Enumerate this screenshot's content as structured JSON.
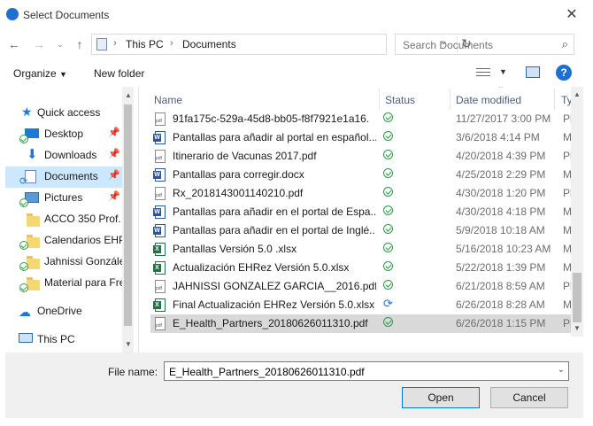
{
  "window": {
    "title": "Select Documents"
  },
  "nav": {
    "back": "←",
    "forward": "→",
    "up": "↑",
    "refresh": "↻"
  },
  "address": {
    "crumbs": [
      "This PC",
      "Documents"
    ]
  },
  "search": {
    "placeholder": "Search Documents"
  },
  "commands": {
    "organize": "Organize",
    "new_folder": "New folder"
  },
  "sidebar": {
    "items": [
      {
        "label": "Quick access",
        "pinned": false
      },
      {
        "label": "Desktop",
        "pinned": true
      },
      {
        "label": "Downloads",
        "pinned": true
      },
      {
        "label": "Documents",
        "pinned": true,
        "selected": true
      },
      {
        "label": "Pictures",
        "pinned": true
      },
      {
        "label": "ACCO 350 Prof."
      },
      {
        "label": "Calendarios EHP"
      },
      {
        "label": "Jahnissi González"
      },
      {
        "label": "Material para Fre"
      },
      {
        "label": "OneDrive"
      },
      {
        "label": "This PC"
      }
    ]
  },
  "columns": {
    "name": "Name",
    "status": "Status",
    "date": "Date modified",
    "type": "Ty"
  },
  "files": [
    {
      "name": "91fa175c-529a-45d8-bb05-f8f7921e1a16.",
      "kind": "pdf",
      "status": "ok",
      "date": "11/27/2017 3:00 PM",
      "type": "Pl"
    },
    {
      "name": "Pantallas para añadir al portal en español...",
      "kind": "word",
      "status": "ok",
      "date": "3/6/2018 4:14 PM",
      "type": "M"
    },
    {
      "name": "Itinerario de Vacunas 2017.pdf",
      "kind": "pdf",
      "status": "ok",
      "date": "4/20/2018 4:39 PM",
      "type": "Pl"
    },
    {
      "name": "Pantallas para corregir.docx",
      "kind": "word",
      "status": "ok",
      "date": "4/25/2018 2:29 PM",
      "type": "M"
    },
    {
      "name": "Rx_2018143001140210.pdf",
      "kind": "pdf",
      "status": "ok",
      "date": "4/30/2018 1:20 PM",
      "type": "Pl"
    },
    {
      "name": "Pantallas para añadir en el portal de Espa...",
      "kind": "word",
      "status": "ok",
      "date": "4/30/2018 4:18 PM",
      "type": "M"
    },
    {
      "name": "Pantallas para añadir en el portal de Inglé...",
      "kind": "word",
      "status": "ok",
      "date": "5/9/2018 10:18 AM",
      "type": "M"
    },
    {
      "name": "Pantallas Versión 5.0 .xlsx",
      "kind": "excel",
      "status": "ok",
      "date": "5/16/2018 10:23 AM",
      "type": "M"
    },
    {
      "name": "Actualización EHRez Versión 5.0.xlsx",
      "kind": "excel",
      "status": "ok",
      "date": "5/22/2018 1:39 PM",
      "type": "M"
    },
    {
      "name": "JAHNISSI GONZALEZ GARCIA__2016.pdf",
      "kind": "pdf",
      "status": "ok",
      "date": "6/21/2018 8:59 AM",
      "type": "Pl"
    },
    {
      "name": "Final Actualización EHRez Versión 5.0.xlsx",
      "kind": "excel",
      "status": "sync",
      "date": "6/26/2018 8:28 AM",
      "type": "M"
    },
    {
      "name": "E_Health_Partners_20180626011310.pdf",
      "kind": "pdf",
      "status": "ok",
      "date": "6/26/2018 1:15 PM",
      "type": "Pl",
      "selected": true
    }
  ],
  "footer": {
    "filename_label": "File name:",
    "filename_value": "E_Health_Partners_20180626011310.pdf",
    "open_label": "Open",
    "cancel_label": "Cancel"
  }
}
